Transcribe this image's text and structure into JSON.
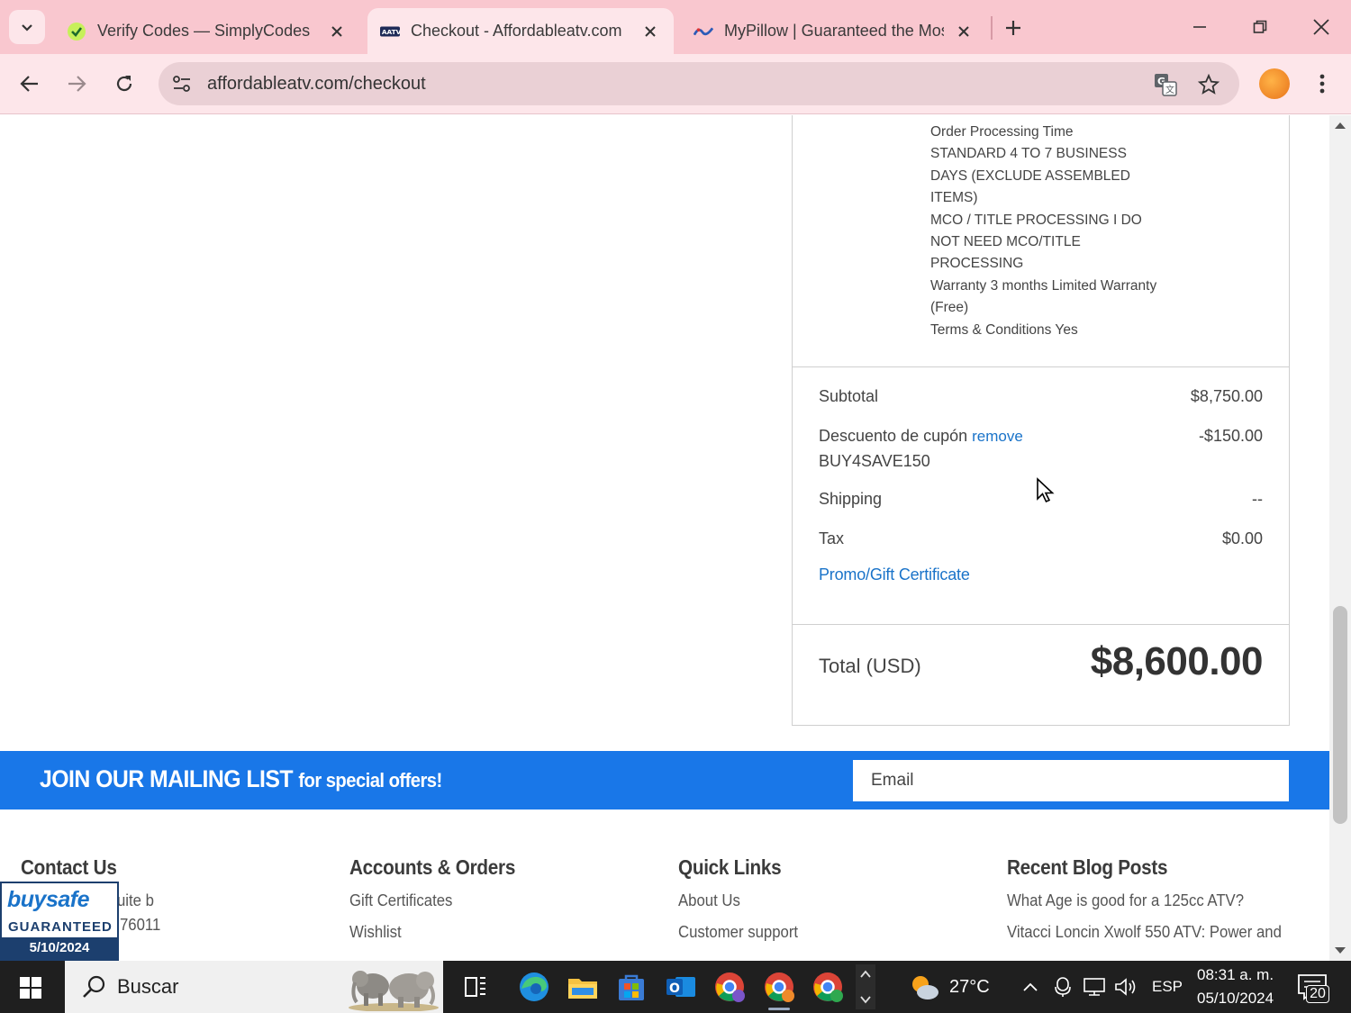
{
  "browser": {
    "tabs": [
      {
        "title": "Verify Codes — SimplyCodes",
        "favicon": "simplycodes-icon",
        "active": false
      },
      {
        "title": "Checkout - Affordableatv.com",
        "favicon": "affordableatv-icon",
        "active": true
      },
      {
        "title": "MyPillow | Guaranteed the Mos",
        "favicon": "mypillow-icon",
        "active": false
      }
    ],
    "url": "affordableatv.com/checkout"
  },
  "order_summary": {
    "item_details": [
      "Order Processing Time",
      "STANDARD 4 TO 7 BUSINESS DAYS (EXCLUDE ASSEMBLED ITEMS)",
      "MCO / TITLE PROCESSING I DO NOT NEED MCO/TITLE PROCESSING",
      "Warranty 3 months Limited Warranty (Free)",
      "Terms & Conditions Yes"
    ],
    "subtotal_label": "Subtotal",
    "subtotal_value": "$8,750.00",
    "coupon_label": "Descuento de cupón",
    "coupon_remove": "remove",
    "coupon_code": "BUY4SAVE150",
    "coupon_value": "-$150.00",
    "shipping_label": "Shipping",
    "shipping_value": "--",
    "tax_label": "Tax",
    "tax_value": "$0.00",
    "promo_link": "Promo/Gift Certificate",
    "total_label": "Total (USD)",
    "total_value": "$8,600.00"
  },
  "mailing_list": {
    "heading_main": "JOIN OUR MAILING LIST",
    "heading_small": "for special offers!",
    "email_placeholder": "Email",
    "background_color": "#1977e8"
  },
  "footer": {
    "contact": {
      "title": "Contact Us",
      "lines": [
        "uite b",
        "76011"
      ]
    },
    "accounts": {
      "title": "Accounts & Orders",
      "links": [
        "Gift Certificates",
        "Wishlist"
      ]
    },
    "quick_links": {
      "title": "Quick Links",
      "links": [
        "About Us",
        "Customer support"
      ]
    },
    "blog": {
      "title": "Recent Blog Posts",
      "links": [
        "What Age is good for a 125cc ATV?",
        "Vitacci Loncin Xwolf 550 ATV: Power and"
      ]
    }
  },
  "buysafe": {
    "logo": "buysafe",
    "guaranteed": "GUARANTEED",
    "date": "5/10/2024"
  },
  "taskbar": {
    "search_text": "Buscar",
    "weather": "27°C",
    "language": "ESP",
    "time": "08:31 a. m.",
    "date": "05/10/2024",
    "notifications": "20"
  }
}
